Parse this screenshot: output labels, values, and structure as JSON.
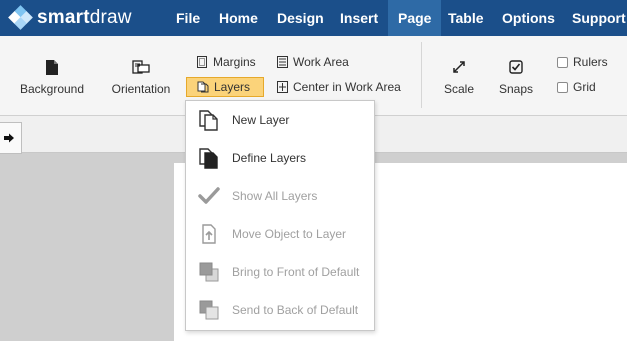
{
  "app": {
    "logo_bold": "smart",
    "logo_light": "draw"
  },
  "menubar": {
    "items": [
      {
        "label": "File"
      },
      {
        "label": "Home"
      },
      {
        "label": "Design"
      },
      {
        "label": "Insert"
      },
      {
        "label": "Page",
        "active": true
      },
      {
        "label": "Table"
      },
      {
        "label": "Options"
      },
      {
        "label": "Support"
      }
    ]
  },
  "ribbon": {
    "background": "Background",
    "orientation": "Orientation",
    "margins": "Margins",
    "layers": "Layers",
    "work_area": "Work Area",
    "center_in_work_area": "Center in Work Area",
    "scale": "Scale",
    "snaps": "Snaps",
    "rulers": "Rulers",
    "grid": "Grid",
    "rulers_checked": false,
    "grid_checked": false
  },
  "layers_menu": {
    "items": [
      {
        "label": "New Layer",
        "icon": "new-layer-icon",
        "enabled": true
      },
      {
        "label": "Define Layers",
        "icon": "define-layers-icon",
        "enabled": true
      },
      {
        "label": "Show All Layers",
        "icon": "checkmark-icon",
        "enabled": false
      },
      {
        "label": "Move Object to Layer",
        "icon": "move-to-layer-icon",
        "enabled": false
      },
      {
        "label": "Bring to Front of Default",
        "icon": "bring-front-icon",
        "enabled": false
      },
      {
        "label": "Send to Back of Default",
        "icon": "send-back-icon",
        "enabled": false
      }
    ]
  },
  "colors": {
    "menubar": "#1b4f8a",
    "menubar_active": "#2e6aa6",
    "highlight": "#fbd37a",
    "disabled_text": "#a0a0a0"
  }
}
